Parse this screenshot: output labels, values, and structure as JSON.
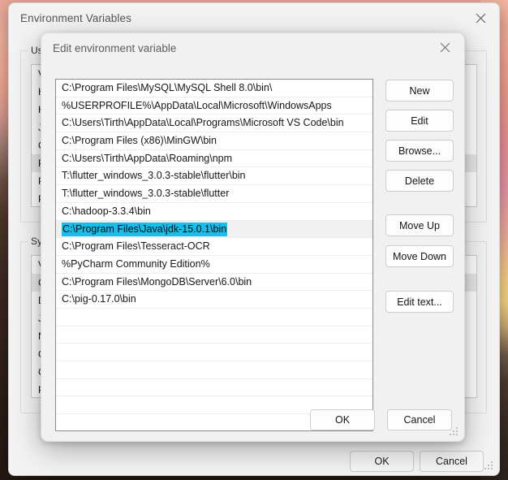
{
  "wallpaper": {
    "description": "sunset-gradient-wallpaper",
    "top_color": "#f0b3a0",
    "mid_color": "#f3d47e",
    "bottom_color": "#241812"
  },
  "env_window": {
    "title": "Environment Variables",
    "close_icon": "close-icon",
    "user_section": {
      "label": "User",
      "column_header": "Va",
      "rows": [
        "HA",
        "HA",
        "JA",
        "On",
        "Pa",
        "Pl",
        "Pv"
      ],
      "selected_row": "Pa"
    },
    "system_section": {
      "label": "Syste",
      "column_header": "Va",
      "rows": [
        "Co",
        "Dr",
        "JA",
        "NU",
        "On",
        "OS",
        "Pa"
      ],
      "selected_row": "Co"
    },
    "buttons": {
      "ok": "OK",
      "cancel": "Cancel"
    }
  },
  "edit_dialog": {
    "title": "Edit environment variable",
    "close_icon": "close-icon",
    "paths": [
      "C:\\Program Files\\MySQL\\MySQL Shell 8.0\\bin\\",
      "%USERPROFILE%\\AppData\\Local\\Microsoft\\WindowsApps",
      "C:\\Users\\Tirth\\AppData\\Local\\Programs\\Microsoft VS Code\\bin",
      "C:\\Program Files (x86)\\MinGW\\bin",
      "C:\\Users\\Tirth\\AppData\\Roaming\\npm",
      "T:\\flutter_windows_3.0.3-stable\\flutter\\bin",
      "T:\\flutter_windows_3.0.3-stable\\flutter",
      "C:\\hadoop-3.3.4\\bin",
      "C:\\Program Files\\Java\\jdk-15.0.1\\bin",
      "C:\\Program Files\\Tesseract-OCR",
      "%PyCharm Community Edition%",
      "C:\\Program Files\\MongoDB\\Server\\6.0\\bin",
      "C:\\pig-0.17.0\\bin"
    ],
    "selected_index": 8,
    "selected_path": "C:\\Program Files\\Java\\jdk-15.0.1\\bin",
    "selection_color": "#18bdec",
    "empty_row_count": 7,
    "side_buttons": [
      {
        "label": "New",
        "name": "new-button"
      },
      {
        "label": "Edit",
        "name": "edit-button"
      },
      {
        "label": "Browse...",
        "name": "browse-button"
      },
      {
        "label": "Delete",
        "name": "delete-button"
      },
      {
        "label": "Move Up",
        "name": "move-up-button"
      },
      {
        "label": "Move Down",
        "name": "move-down-button"
      },
      {
        "label": "Edit text...",
        "name": "edit-text-button"
      }
    ],
    "buttons": {
      "ok": "OK",
      "cancel": "Cancel"
    },
    "resize_grip": "resize-grip"
  }
}
